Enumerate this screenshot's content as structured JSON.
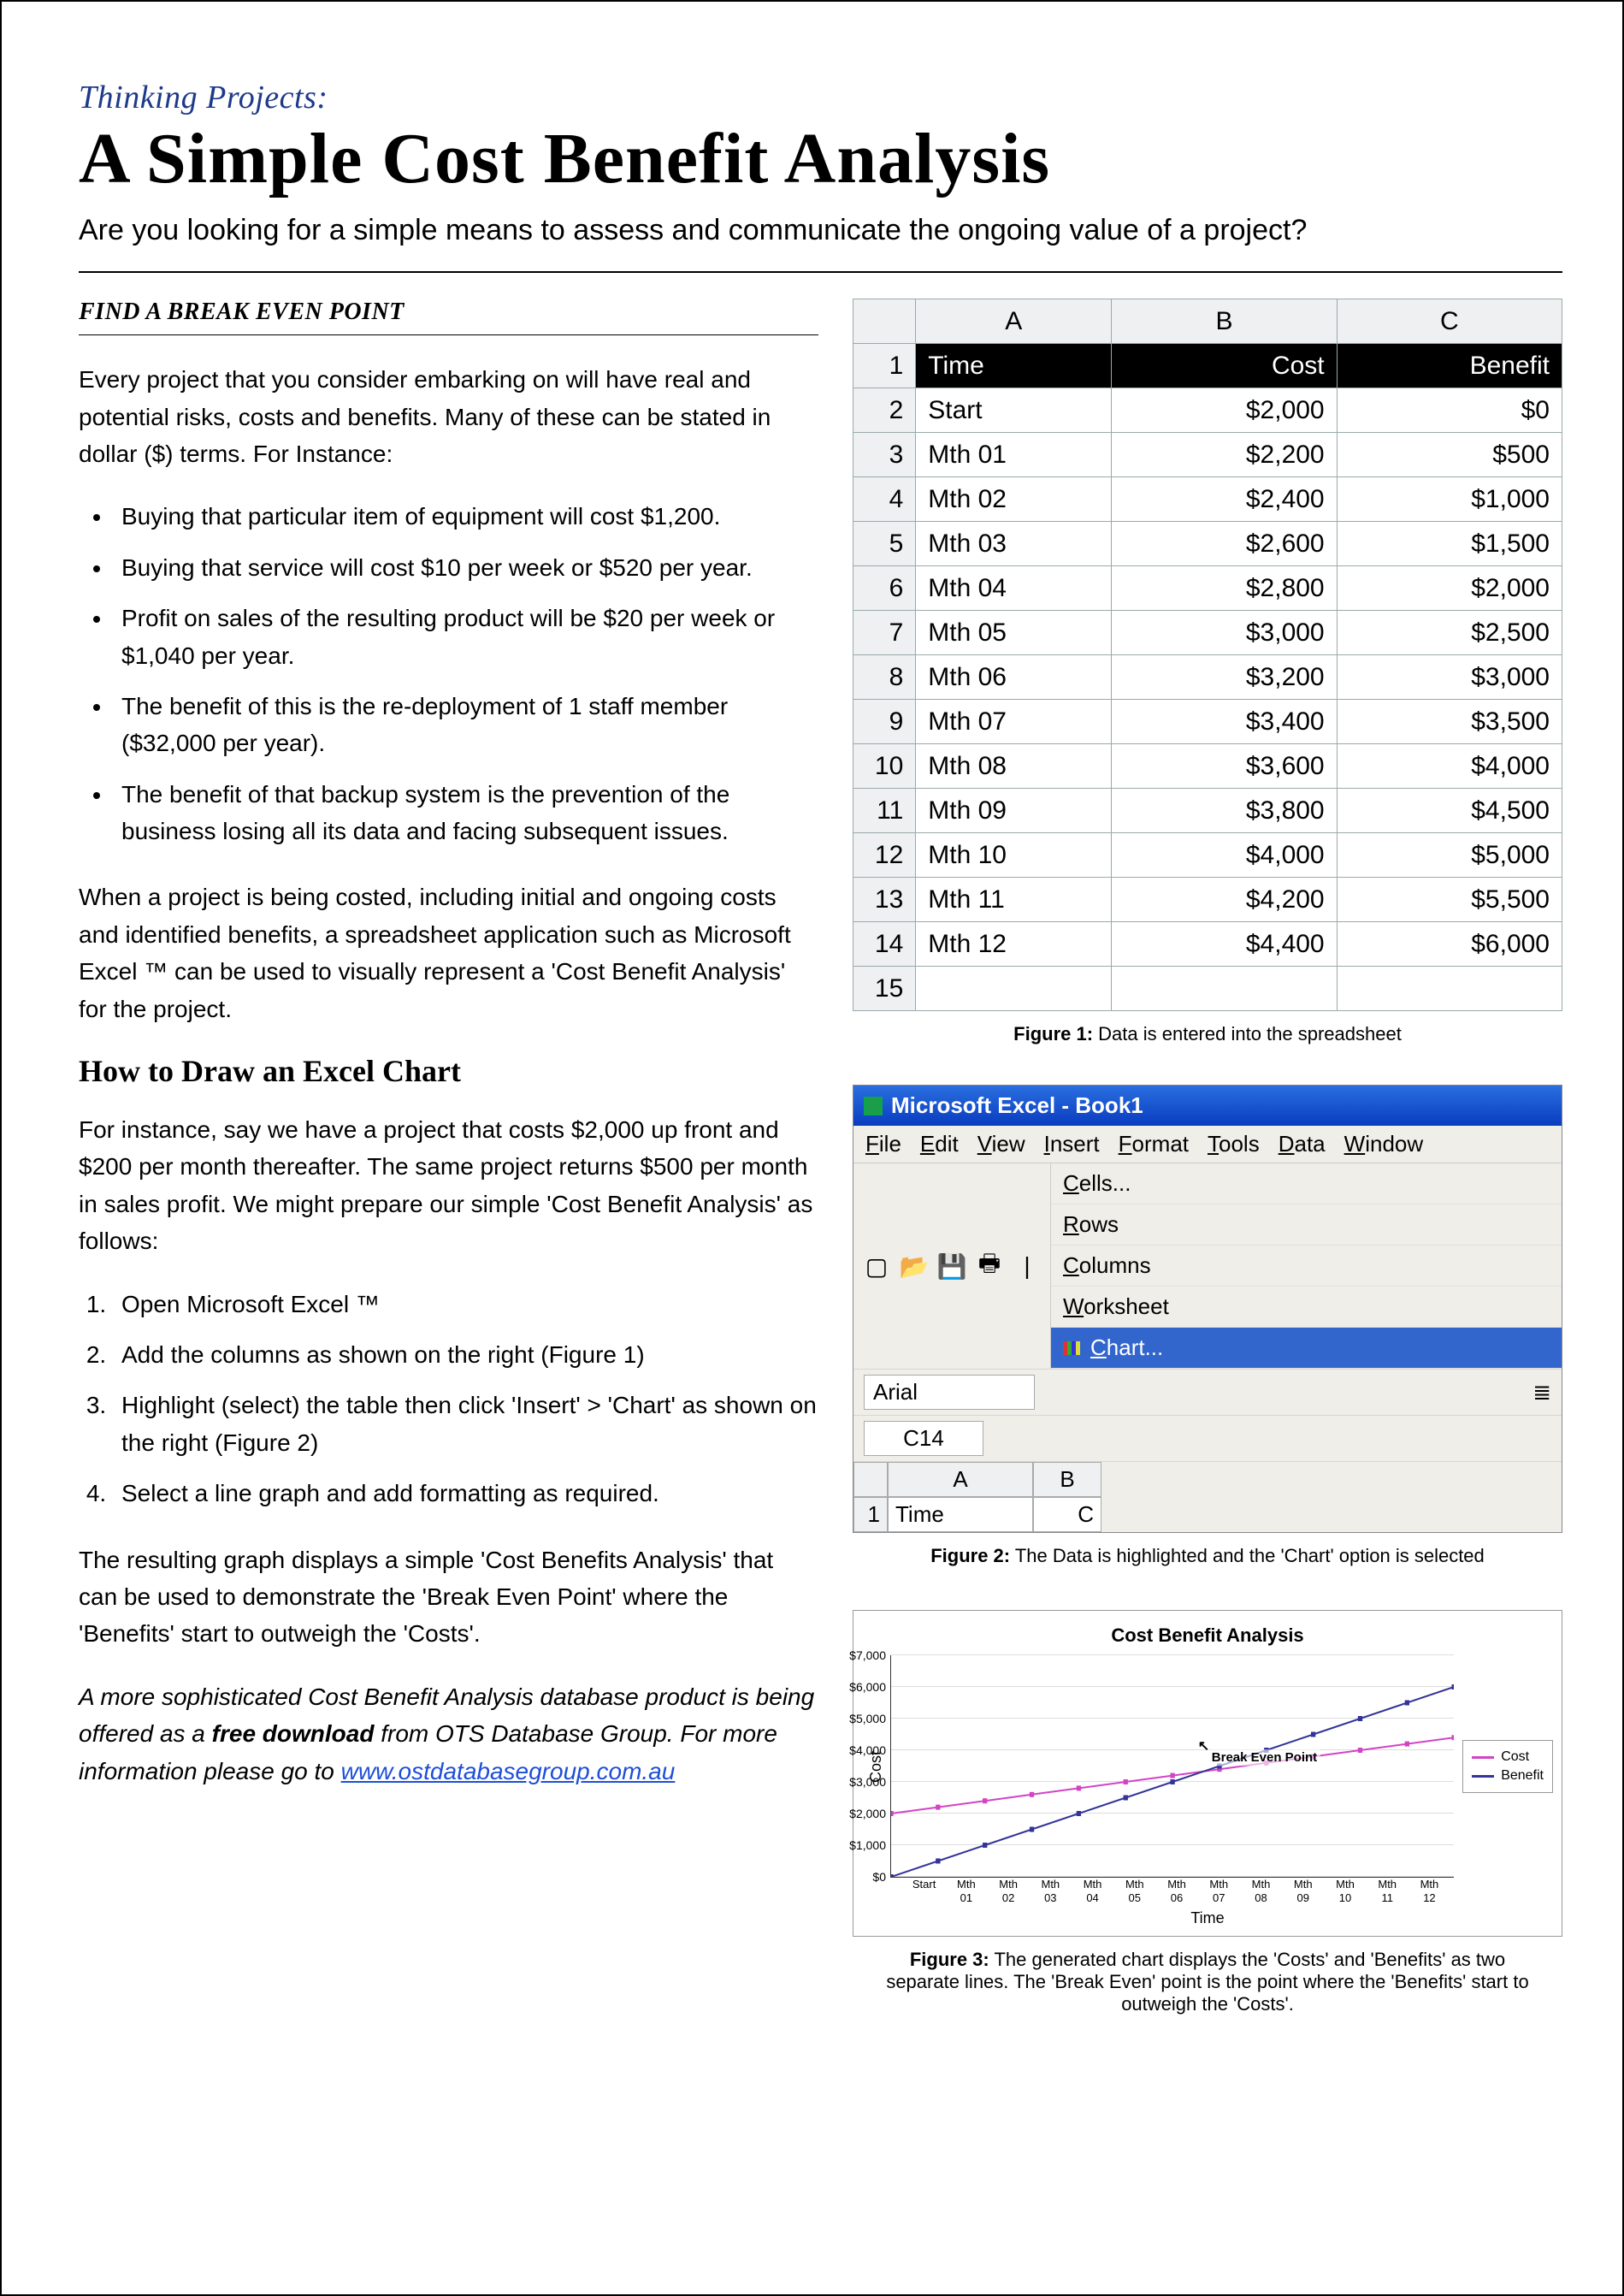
{
  "header": {
    "series": "Thinking Projects:",
    "title": "A Simple Cost Benefit Analysis",
    "subtitle": "Are you looking for a simple means to assess and communicate the ongoing value of a project?"
  },
  "left": {
    "subhead": "FIND A BREAK EVEN POINT",
    "intro": "Every project that you consider embarking on will have real and potential risks, costs and benefits.  Many of these can be stated in dollar ($) terms.  For Instance:",
    "bullets": [
      "Buying that particular item of equipment will cost $1,200.",
      "Buying that service will cost $10 per week or $520 per year.",
      "Profit on sales of the resulting product will be $20 per week or $1,040 per year.",
      "The benefit of this is the re-deployment of 1 staff member ($32,000 per year).",
      "The benefit of that backup system is the prevention of the business losing all its data and facing subsequent issues."
    ],
    "after_bullets": "When a project is being costed, including initial and ongoing costs and identified benefits, a spreadsheet application such as Microsoft Excel ™ can be used to visually represent a 'Cost Benefit Analysis' for the project.",
    "howto_title": "How to Draw an Excel Chart",
    "howto_intro": "For instance, say we have a project that costs $2,000 up front and $200 per month thereafter. The same project returns $500 per month in sales profit.  We might prepare our simple 'Cost Benefit Analysis' as follows:",
    "steps": [
      "Open Microsoft Excel ™",
      "Add the columns as shown on the right (Figure 1)",
      "Highlight (select) the table then click 'Insert' > 'Chart' as shown on the right (Figure 2)",
      "Select a line graph and add formatting as required."
    ],
    "result_para": "The resulting graph displays a simple 'Cost Benefits Analysis' that can be used to demonstrate the 'Break Even Point' where the 'Benefits' start to outweigh the 'Costs'.",
    "footer_prefix": "A more sophisticated Cost Benefit Analysis database product is being offered as a ",
    "footer_bold": "free download",
    "footer_suffix": " from OTS Database Group.  For more information please go to ",
    "link_text": "www.ostdatabasegroup.com.au"
  },
  "spreadsheet": {
    "col_letters": [
      "A",
      "B",
      "C"
    ],
    "headers": [
      "Time",
      "Cost",
      "Benefit"
    ],
    "rows": [
      {
        "n": 2,
        "time": "Start",
        "cost": "$2,000",
        "benefit": "$0"
      },
      {
        "n": 3,
        "time": "Mth 01",
        "cost": "$2,200",
        "benefit": "$500"
      },
      {
        "n": 4,
        "time": "Mth 02",
        "cost": "$2,400",
        "benefit": "$1,000"
      },
      {
        "n": 5,
        "time": "Mth 03",
        "cost": "$2,600",
        "benefit": "$1,500"
      },
      {
        "n": 6,
        "time": "Mth 04",
        "cost": "$2,800",
        "benefit": "$2,000"
      },
      {
        "n": 7,
        "time": "Mth 05",
        "cost": "$3,000",
        "benefit": "$2,500"
      },
      {
        "n": 8,
        "time": "Mth 06",
        "cost": "$3,200",
        "benefit": "$3,000"
      },
      {
        "n": 9,
        "time": "Mth 07",
        "cost": "$3,400",
        "benefit": "$3,500"
      },
      {
        "n": 10,
        "time": "Mth 08",
        "cost": "$3,600",
        "benefit": "$4,000"
      },
      {
        "n": 11,
        "time": "Mth 09",
        "cost": "$3,800",
        "benefit": "$4,500"
      },
      {
        "n": 12,
        "time": "Mth 10",
        "cost": "$4,000",
        "benefit": "$5,000"
      },
      {
        "n": 13,
        "time": "Mth 11",
        "cost": "$4,200",
        "benefit": "$5,500"
      },
      {
        "n": 14,
        "time": "Mth 12",
        "cost": "$4,400",
        "benefit": "$6,000"
      }
    ],
    "empty_row": 15
  },
  "captions": {
    "fig1_label": "Figure 1:",
    "fig1_text": " Data is entered into the spreadsheet",
    "fig2_label": "Figure 2:",
    "fig2_text": "  The Data is highlighted and the 'Chart' option is selected",
    "fig3_label": "Figure 3:",
    "fig3_text": " The generated chart displays the 'Costs' and 'Benefits' as two separate lines.  The 'Break Even' point is the point where the 'Benefits' start to outweigh the 'Costs'."
  },
  "excel_menu": {
    "titlebar": "Microsoft Excel - Book1",
    "menus": [
      "File",
      "Edit",
      "View",
      "Insert",
      "Format",
      "Tools",
      "Data",
      "Window"
    ],
    "dropdown": [
      "Cells...",
      "Rows",
      "Columns",
      "Worksheet",
      "Chart..."
    ],
    "selected_index": 4,
    "font": "Arial",
    "cellref": "C14",
    "grid_headers": [
      "A",
      "B"
    ],
    "row1_num": "1",
    "row1_a": "Time",
    "row1_b": "C"
  },
  "chart_data": {
    "type": "line",
    "title": "Cost Benefit Analysis",
    "xlabel": "Time",
    "ylabel": "Cost",
    "categories": [
      "Start",
      "Mth 01",
      "Mth 02",
      "Mth 03",
      "Mth 04",
      "Mth 05",
      "Mth 06",
      "Mth 07",
      "Mth 08",
      "Mth 09",
      "Mth 10",
      "Mth 11",
      "Mth 12"
    ],
    "yticks": [
      "$0",
      "$1,000",
      "$2,000",
      "$3,000",
      "$4,000",
      "$5,000",
      "$6,000",
      "$7,000"
    ],
    "ylim": [
      0,
      7000
    ],
    "series": [
      {
        "name": "Cost",
        "color": "#d244c5",
        "values": [
          2000,
          2200,
          2400,
          2600,
          2800,
          3000,
          3200,
          3400,
          3600,
          3800,
          4000,
          4200,
          4400
        ]
      },
      {
        "name": "Benefit",
        "color": "#333399",
        "values": [
          0,
          500,
          1000,
          1500,
          2000,
          2500,
          3000,
          3500,
          4000,
          4500,
          5000,
          5500,
          6000
        ]
      }
    ],
    "annotation": "Break Even Point",
    "annotation_x_index": 7
  }
}
